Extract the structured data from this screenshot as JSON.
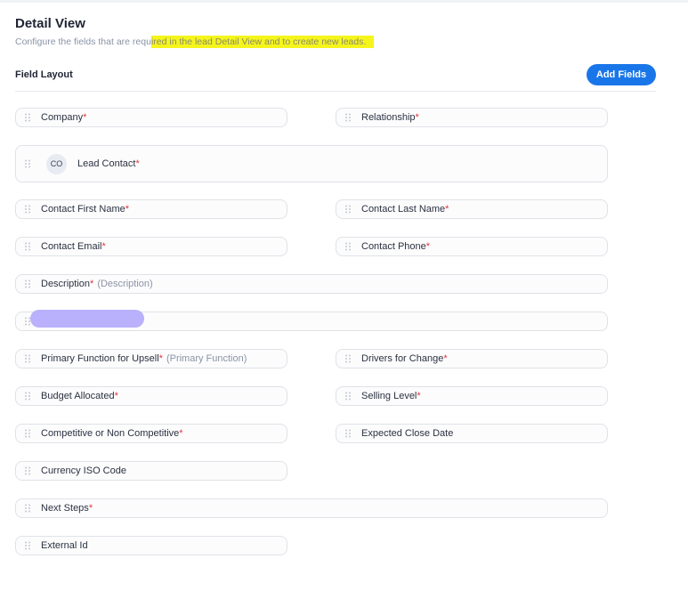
{
  "header": {
    "title": "Detail View",
    "subtitle_plain": "Configure the fields that are requ",
    "subtitle_highlighted": "ired in the lead Detail View and to create new leads."
  },
  "section": {
    "title": "Field Layout",
    "add_button_label": "Add Fields"
  },
  "colors": {
    "accent": "#1976e8",
    "required": "#e0353b",
    "highlight": "#f5f51c",
    "redaction": "#b9b1fb"
  },
  "fields": {
    "company": {
      "label": "Company",
      "req": "*"
    },
    "relationship": {
      "label": "Relationship",
      "req": "*"
    },
    "lead_contact": {
      "avatar": "CO",
      "label": "Lead Contact",
      "req": "*"
    },
    "contact_first_name": {
      "label": "Contact First Name",
      "req": "*"
    },
    "contact_last_name": {
      "label": "Contact Last Name",
      "req": "*"
    },
    "contact_email": {
      "label": "Contact Email",
      "req": "*"
    },
    "contact_phone": {
      "label": "Contact Phone",
      "req": "*"
    },
    "description": {
      "label": "Description",
      "req": "*",
      "hint": "(Description)"
    },
    "primary_function": {
      "label": "Primary Function for Upsell",
      "req": "*",
      "hint": "(Primary Function)"
    },
    "drivers_for_change": {
      "label": "Drivers for Change",
      "req": "*"
    },
    "budget_allocated": {
      "label": "Budget Allocated",
      "req": "*"
    },
    "selling_level": {
      "label": "Selling Level",
      "req": "*"
    },
    "competitive": {
      "label": "Competitive or Non Competitive",
      "req": "*"
    },
    "expected_close_date": {
      "label": "Expected Close Date"
    },
    "currency_iso_code": {
      "label": "Currency ISO Code"
    },
    "next_steps": {
      "label": "Next Steps",
      "req": "*"
    },
    "external_id": {
      "label": "External Id"
    }
  }
}
